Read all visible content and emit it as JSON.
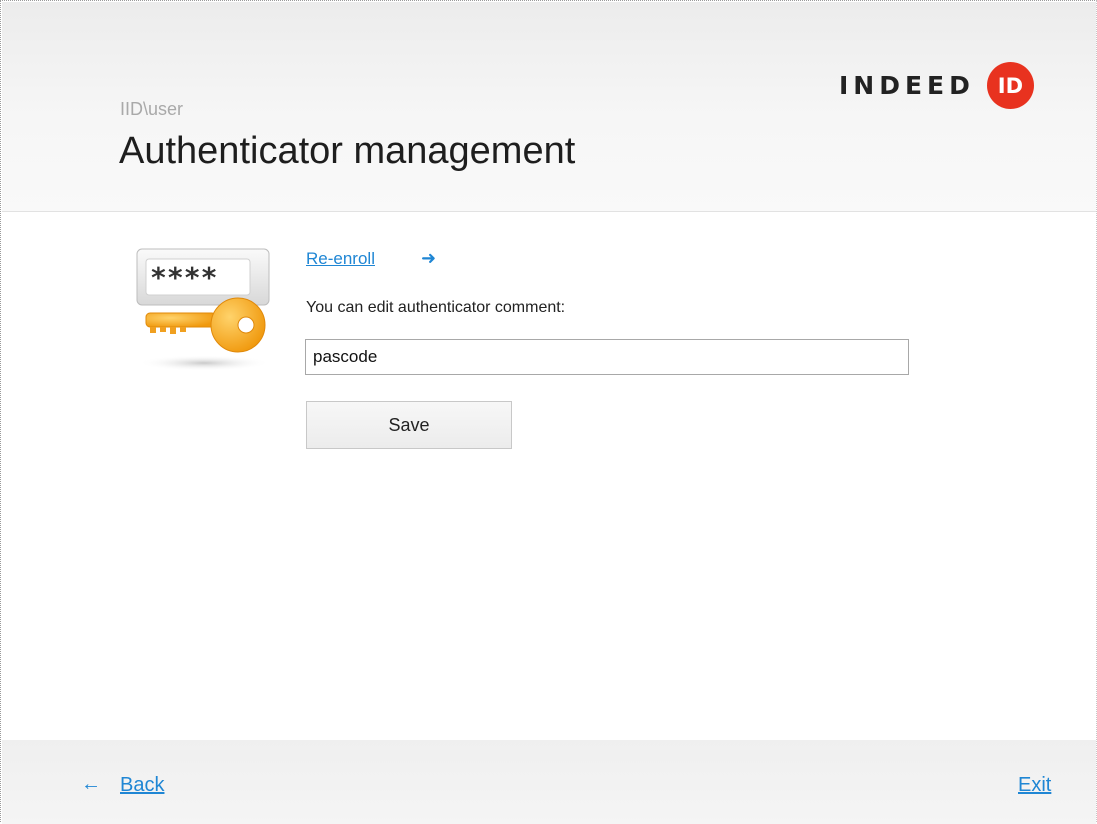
{
  "header": {
    "user": "IID\\user",
    "title": "Authenticator management",
    "logo_text": "INDEED",
    "logo_badge": "ID"
  },
  "authenticator": {
    "icon": "password-key-icon",
    "mask": "****"
  },
  "content": {
    "reenroll_label": "Re-enroll",
    "reenroll_arrow": "➜",
    "comment_label": "You can edit authenticator comment:",
    "comment_value": "pascode",
    "save_label": "Save"
  },
  "footer": {
    "back_arrow": "←",
    "back_label": "Back",
    "exit_label": "Exit"
  },
  "colors": {
    "link": "#1f86d4",
    "logo_red": "#e8321f",
    "key_orange": "#f5a623"
  }
}
